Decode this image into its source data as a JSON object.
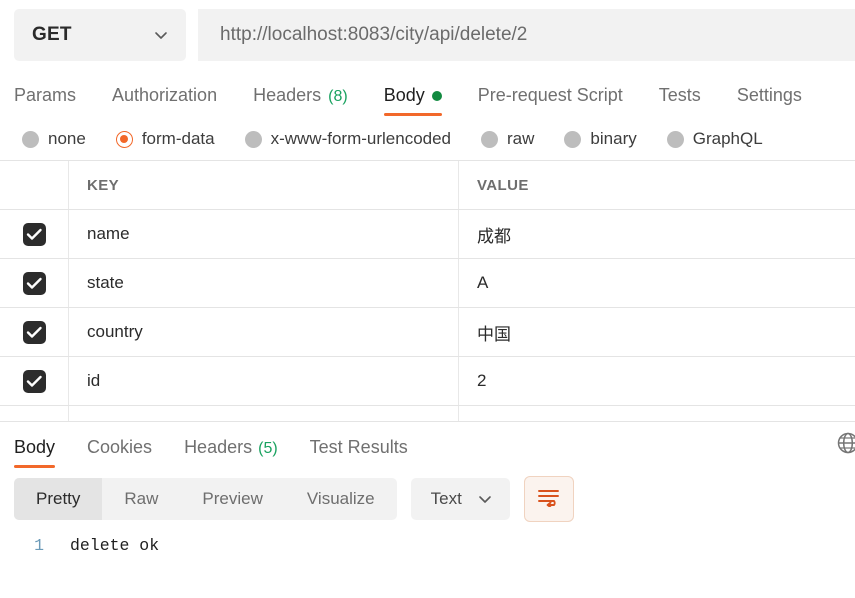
{
  "request": {
    "method": "GET",
    "method_icon": "chevron-down-icon",
    "url": "http://localhost:8083/city/api/delete/2",
    "tabs": [
      {
        "label": "Params",
        "active": false,
        "count": null,
        "dot": false
      },
      {
        "label": "Authorization",
        "active": false,
        "count": null,
        "dot": false
      },
      {
        "label": "Headers",
        "active": false,
        "count": "(8)",
        "dot": false
      },
      {
        "label": "Body",
        "active": true,
        "count": null,
        "dot": true
      },
      {
        "label": "Pre-request Script",
        "active": false,
        "count": null,
        "dot": false
      },
      {
        "label": "Tests",
        "active": false,
        "count": null,
        "dot": false
      },
      {
        "label": "Settings",
        "active": false,
        "count": null,
        "dot": false
      }
    ],
    "body_types": [
      {
        "label": "none",
        "selected": false
      },
      {
        "label": "form-data",
        "selected": true
      },
      {
        "label": "x-www-form-urlencoded",
        "selected": false
      },
      {
        "label": "raw",
        "selected": false
      },
      {
        "label": "binary",
        "selected": false
      },
      {
        "label": "GraphQL",
        "selected": false
      }
    ],
    "table": {
      "columns": [
        "KEY",
        "VALUE"
      ],
      "rows": [
        {
          "checked": true,
          "key": "name",
          "value": "成都"
        },
        {
          "checked": true,
          "key": "state",
          "value": "A"
        },
        {
          "checked": true,
          "key": "country",
          "value": "中国"
        },
        {
          "checked": true,
          "key": "id",
          "value": "2"
        }
      ]
    }
  },
  "response": {
    "tabs": [
      {
        "label": "Body",
        "active": true,
        "count": null
      },
      {
        "label": "Cookies",
        "active": false,
        "count": null
      },
      {
        "label": "Headers",
        "active": false,
        "count": "(5)"
      },
      {
        "label": "Test Results",
        "active": false,
        "count": null
      }
    ],
    "globe_icon": "globe-icon",
    "view_modes": [
      {
        "label": "Pretty",
        "active": true
      },
      {
        "label": "Raw",
        "active": false
      },
      {
        "label": "Preview",
        "active": false
      },
      {
        "label": "Visualize",
        "active": false
      }
    ],
    "format_type": "Text",
    "format_chevron": "chevron-down-icon",
    "wrap_button_icon": "word-wrap-icon",
    "body_lines": [
      {
        "number": "1",
        "text": "delete ok"
      }
    ]
  },
  "colors": {
    "accent": "#f2682a",
    "tab_count_green": "#1aa260",
    "body_dot_green": "#128a40",
    "field_bg": "#f2f2f2",
    "checkbox": "#2c2c2c",
    "line_number": "#6b9ab8"
  }
}
